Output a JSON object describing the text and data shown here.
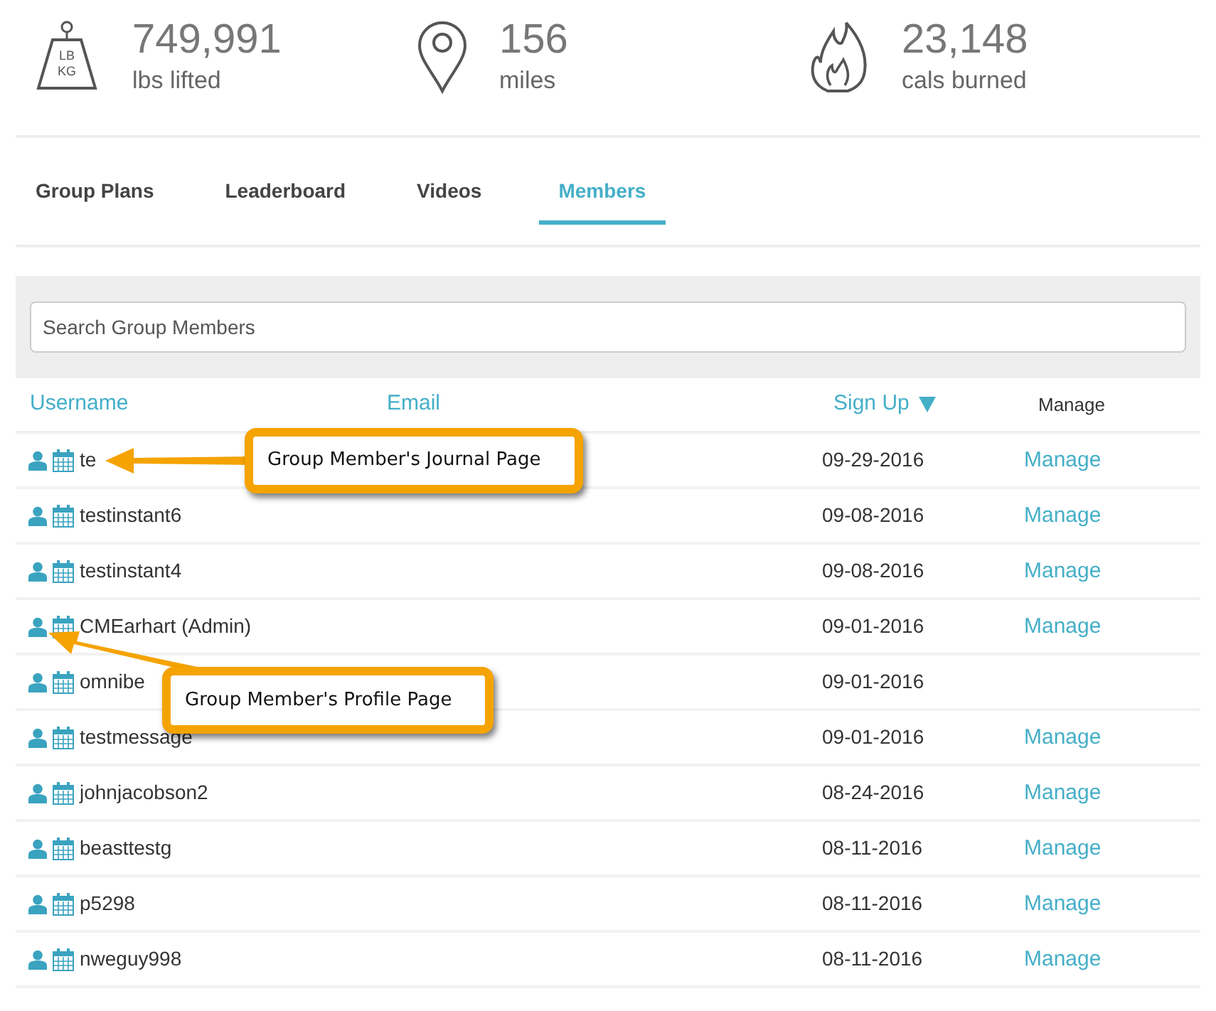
{
  "stats": [
    {
      "kind": "weight",
      "value": "749,991",
      "label": "lbs lifted",
      "icon_text": [
        "LB",
        "KG"
      ]
    },
    {
      "kind": "pin",
      "value": "156",
      "label": "miles"
    },
    {
      "kind": "flame",
      "value": "23,148",
      "label": "cals burned"
    }
  ],
  "tabs": [
    {
      "label": "Group Plans",
      "selected": false
    },
    {
      "label": "Leaderboard",
      "selected": false
    },
    {
      "label": "Videos",
      "selected": false
    },
    {
      "label": "Members",
      "selected": true
    }
  ],
  "search": {
    "placeholder": "Search Group Members"
  },
  "table": {
    "columns": [
      {
        "label": "Username",
        "kind": "link"
      },
      {
        "label": "Email",
        "kind": "link"
      },
      {
        "label": "Sign Up",
        "kind": "sorted"
      },
      {
        "label": "Manage",
        "kind": "plain"
      }
    ],
    "rows": [
      {
        "username": "te",
        "signup": "09-29-2016",
        "manage": "Manage"
      },
      {
        "username": "testinstant6",
        "signup": "09-08-2016",
        "manage": "Manage"
      },
      {
        "username": "testinstant4",
        "signup": "09-08-2016",
        "manage": "Manage"
      },
      {
        "username": "CMEarhart (Admin)",
        "signup": "09-01-2016",
        "manage": "Manage"
      },
      {
        "username": "omnibe",
        "signup": "09-01-2016"
      },
      {
        "username": "testmessage",
        "signup": "09-01-2016",
        "manage": "Manage"
      },
      {
        "username": "johnjacobson2",
        "signup": "08-24-2016",
        "manage": "Manage"
      },
      {
        "username": "beasttestg",
        "signup": "08-11-2016",
        "manage": "Manage"
      },
      {
        "username": "p5298",
        "signup": "08-11-2016",
        "manage": "Manage"
      },
      {
        "username": "nweguy998",
        "signup": "08-11-2016",
        "manage": "Manage"
      }
    ]
  },
  "callouts": [
    {
      "text": "Group Member's Journal Page",
      "kind": "journal"
    },
    {
      "text": "Group Member's Profile Page",
      "kind": "profile"
    }
  ]
}
